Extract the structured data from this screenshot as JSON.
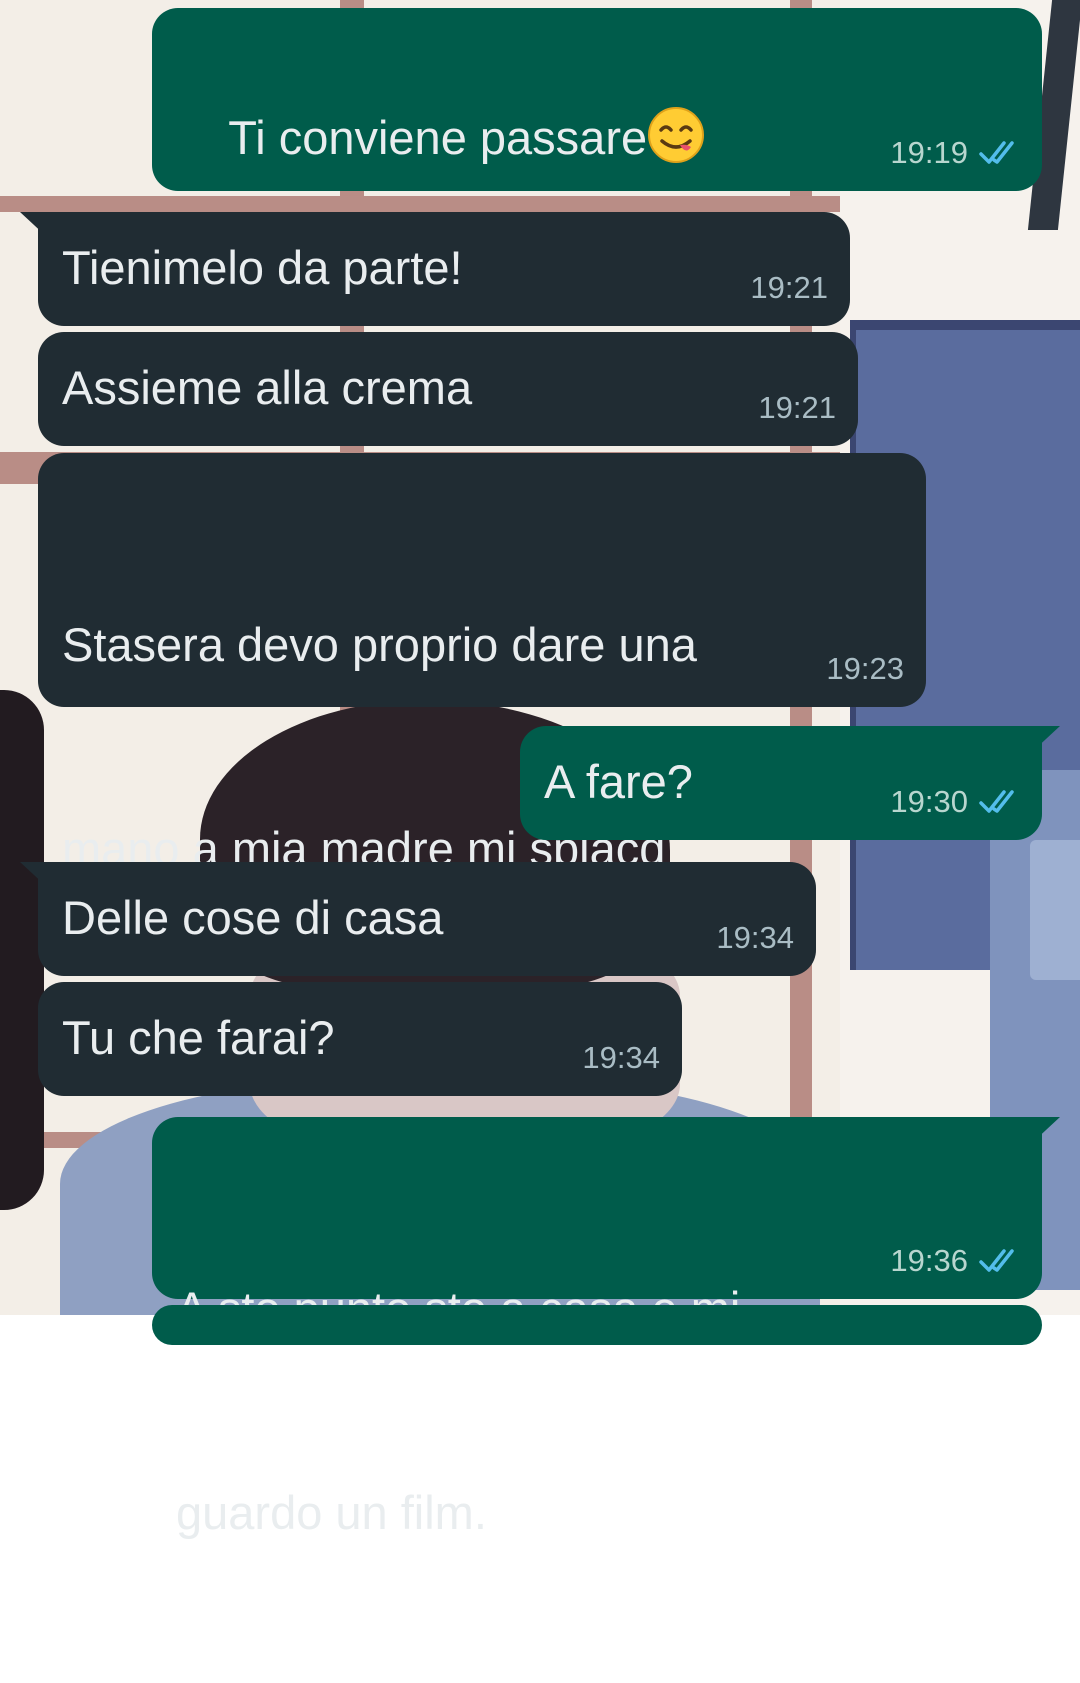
{
  "chat": {
    "messages": [
      {
        "id": "m1",
        "direction": "outgoing",
        "text": "Ti conviene passare",
        "emoji": "face-savoring-food",
        "time": "19:19",
        "status": "read"
      },
      {
        "id": "m2",
        "direction": "incoming",
        "text": "Tienimelo da parte!",
        "time": "19:21"
      },
      {
        "id": "m3",
        "direction": "incoming",
        "text": "Assieme alla crema",
        "time": "19:21"
      },
      {
        "id": "m4",
        "direction": "incoming",
        "text": "Stasera devo proprio dare una mano a mia madre mi spiacd",
        "line1": "Stasera devo proprio dare una",
        "line2": "mano a mia madre mi spiacd",
        "time": "19:23"
      },
      {
        "id": "m5",
        "direction": "outgoing",
        "text": "A fare?",
        "time": "19:30",
        "status": "read"
      },
      {
        "id": "m6",
        "direction": "incoming",
        "text": "Delle cose di casa",
        "time": "19:34"
      },
      {
        "id": "m7",
        "direction": "incoming",
        "text": "Tu che farai?",
        "time": "19:34"
      },
      {
        "id": "m8",
        "direction": "outgoing",
        "text": "A sto punto sto a casa e mi guardo un film.",
        "line1": "A sto punto sto a casa e mi",
        "line2": "guardo un film.",
        "time": "19:36",
        "status": "read"
      }
    ]
  },
  "colors": {
    "outgoing_bubble": "#005c4b",
    "incoming_bubble": "#202c33",
    "text": "#e9edef",
    "read_tick": "#53bdeb"
  },
  "icons": {
    "read_receipt": "double-check-icon",
    "emoji": "face-savoring-food-emoji"
  }
}
